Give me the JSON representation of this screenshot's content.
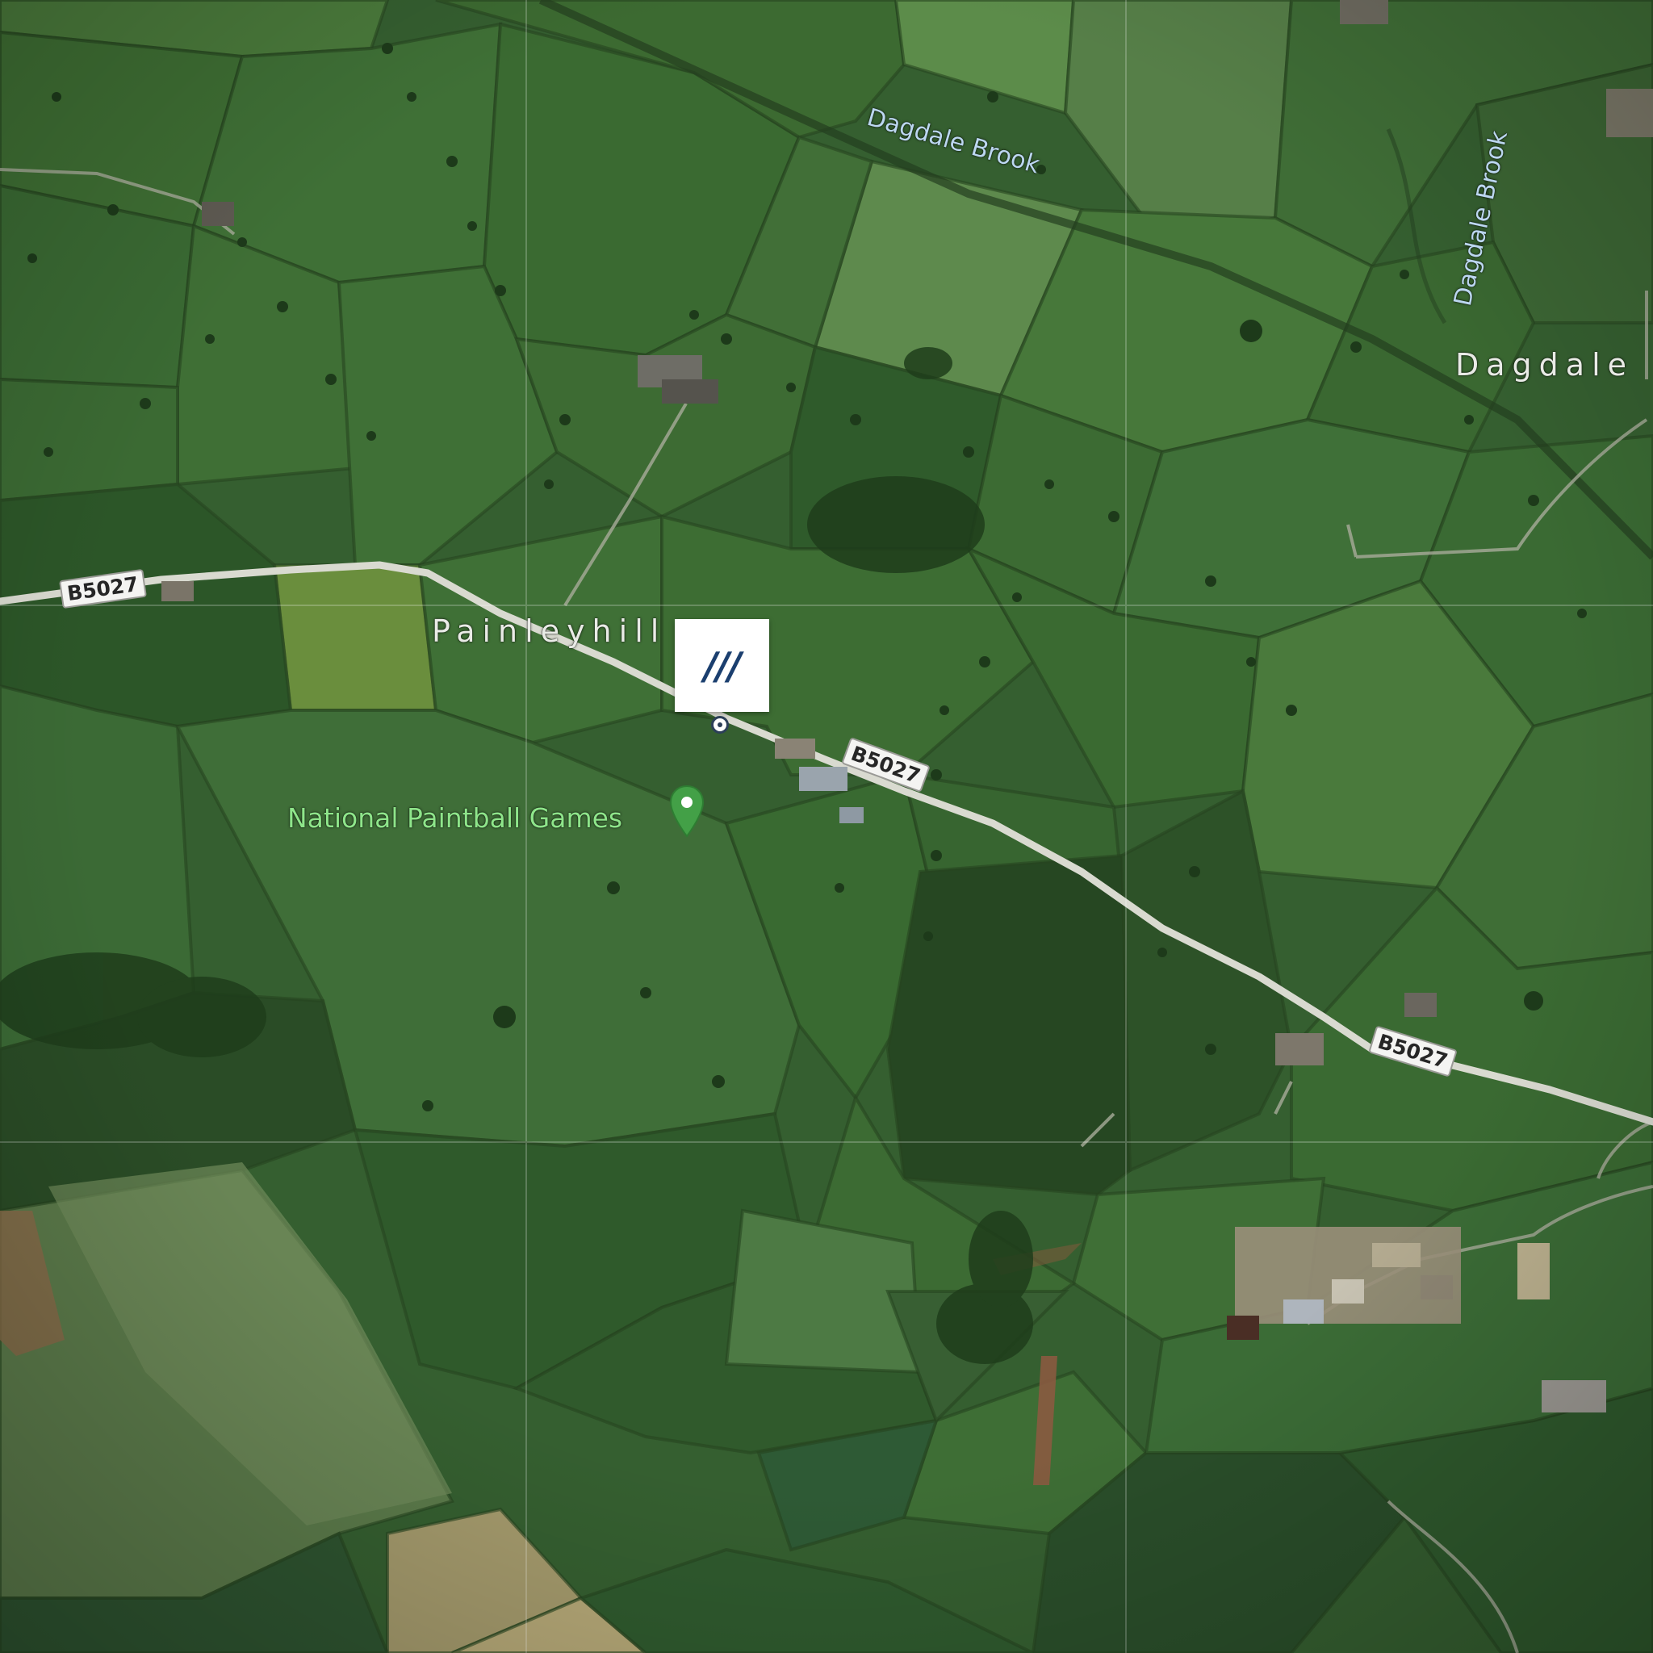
{
  "map": {
    "type": "satellite",
    "places": {
      "painleyhill": "Painleyhill",
      "dagdale": "Dagdale"
    },
    "water": {
      "brook_a": "Dagdale Brook",
      "brook_b": "Dagdale Brook"
    },
    "roads": {
      "shield_west": "B5027",
      "shield_mid": "B5027",
      "shield_east": "B5027"
    },
    "poi": {
      "name": "National Paintball Games",
      "pin_color": "#43a047",
      "icon": "location-pin-icon"
    },
    "marker": {
      "label": "///",
      "brand_color": "#1b3f6f"
    }
  }
}
